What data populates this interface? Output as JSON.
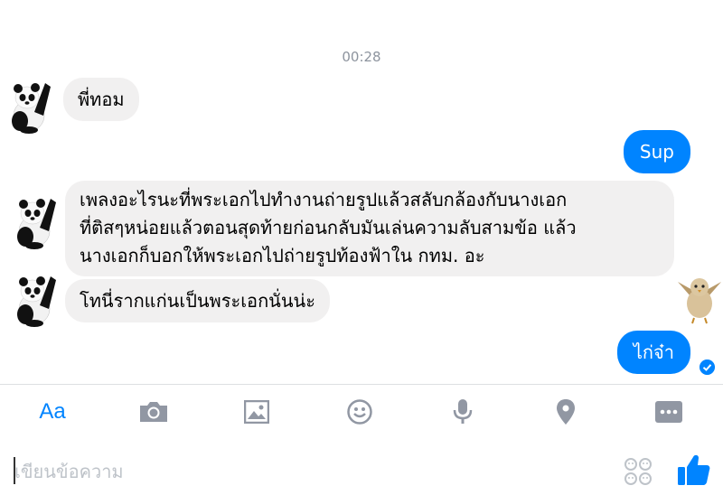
{
  "messages": {
    "timestamp": "00:28",
    "m1": "พี่ทอม",
    "m2": "Sup",
    "m3_line1": "เพลงอะไรนะที่พระเอกไปทำงานถ่ายรูปแล้วสลับกล้องกับนางเอก",
    "m3_line2": "ที่ติสๆหน่อยแล้วตอนสุดท้ายก่อนกลับมันเล่นความลับสามข้อ แล้ว",
    "m3_line3": "นางเอกก็บอกให้พระเอกไปถ่ายรูปท้องฟ้าใน กทม. อะ",
    "m4": "โทนี่รากแก่นเป็นพระเอกนั่นน่ะ",
    "m5": "ไก่จ๋า"
  },
  "toolbar": {
    "aa_label": "Aa",
    "icons": [
      "camera-icon",
      "image-icon",
      "emoji-icon",
      "microphone-icon",
      "location-icon",
      "more-icon"
    ]
  },
  "composer": {
    "placeholder": "เขียนข้อความ"
  },
  "colors": {
    "accent": "#0084ff",
    "incoming_bubble": "#f1f0f0",
    "icon_gray": "#9197a3"
  }
}
